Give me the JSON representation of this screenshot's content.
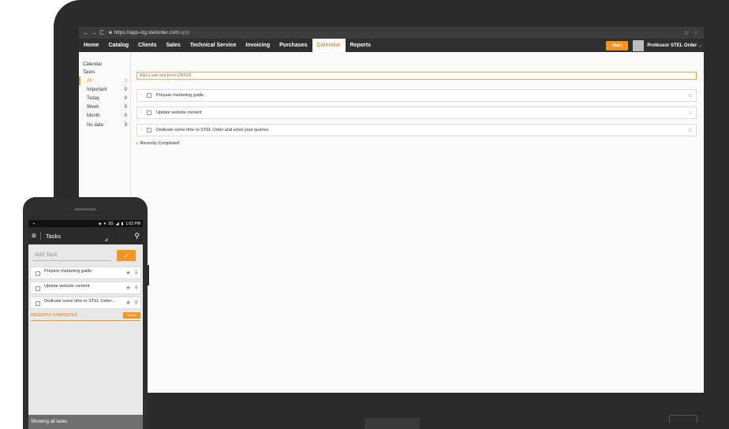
{
  "browser": {
    "back": "←",
    "forward": "→",
    "reload": "C",
    "url_host": "https://app-stg.stelorder.com",
    "url_path": "/app/",
    "bookmark": "☆",
    "menu": "⋮"
  },
  "nav": {
    "items": [
      "Home",
      "Catalog",
      "Clients",
      "Sales",
      "Technical Service",
      "Invoicing",
      "Purchases",
      "Calendar",
      "Reports"
    ],
    "active": "Calendar",
    "start_label": "Start",
    "user": "Professor STEL Order",
    "caret": "⌄"
  },
  "sidebar": {
    "calendar": "Calendar",
    "tasks": "Tasks",
    "filters": [
      {
        "label": "All",
        "count": "3"
      },
      {
        "label": "Important",
        "count": "0"
      },
      {
        "label": "Today",
        "count": "0"
      },
      {
        "label": "Week",
        "count": "0"
      },
      {
        "label": "Month",
        "count": "0"
      },
      {
        "label": "No date",
        "count": "3"
      }
    ]
  },
  "main": {
    "add_placeholder": "Add a task and press ENTER",
    "tasks": [
      {
        "text": "Prepare marketing guide"
      },
      {
        "text": "Update website content"
      },
      {
        "text": "Dedicate some time to STEL Order and solve your queries"
      }
    ],
    "recent_label": "Recently Completed"
  },
  "phone": {
    "status_time": "1:02 PM",
    "status_network": "3G",
    "title": "Tasks",
    "add_placeholder": "Add Task",
    "tasks": [
      {
        "text": "Prepare marketing guide"
      },
      {
        "text": "Update website content"
      },
      {
        "text": "Dedicate some time to STEL Order..."
      }
    ],
    "recent_label": "RECENTLY COMPLETED",
    "show_label": "SHOW",
    "footer": "Showing all tasks"
  },
  "colors": {
    "accent": "#f7941d",
    "navbar": "#2f2f2f",
    "frame": "#2b2b2b"
  }
}
